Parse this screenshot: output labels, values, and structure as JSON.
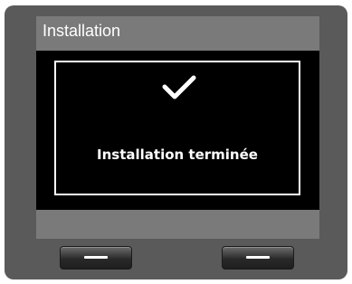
{
  "header": {
    "title": "Installation"
  },
  "dialog": {
    "icon": "checkmark-icon",
    "message": "Installation terminée"
  },
  "softkeys": {
    "left_icon": "dash-icon",
    "right_icon": "dash-icon"
  },
  "colors": {
    "device_body": "#5a5a5a",
    "title_bar": "#7a7a7a",
    "screen_bg": "#000000",
    "text": "#ffffff"
  }
}
